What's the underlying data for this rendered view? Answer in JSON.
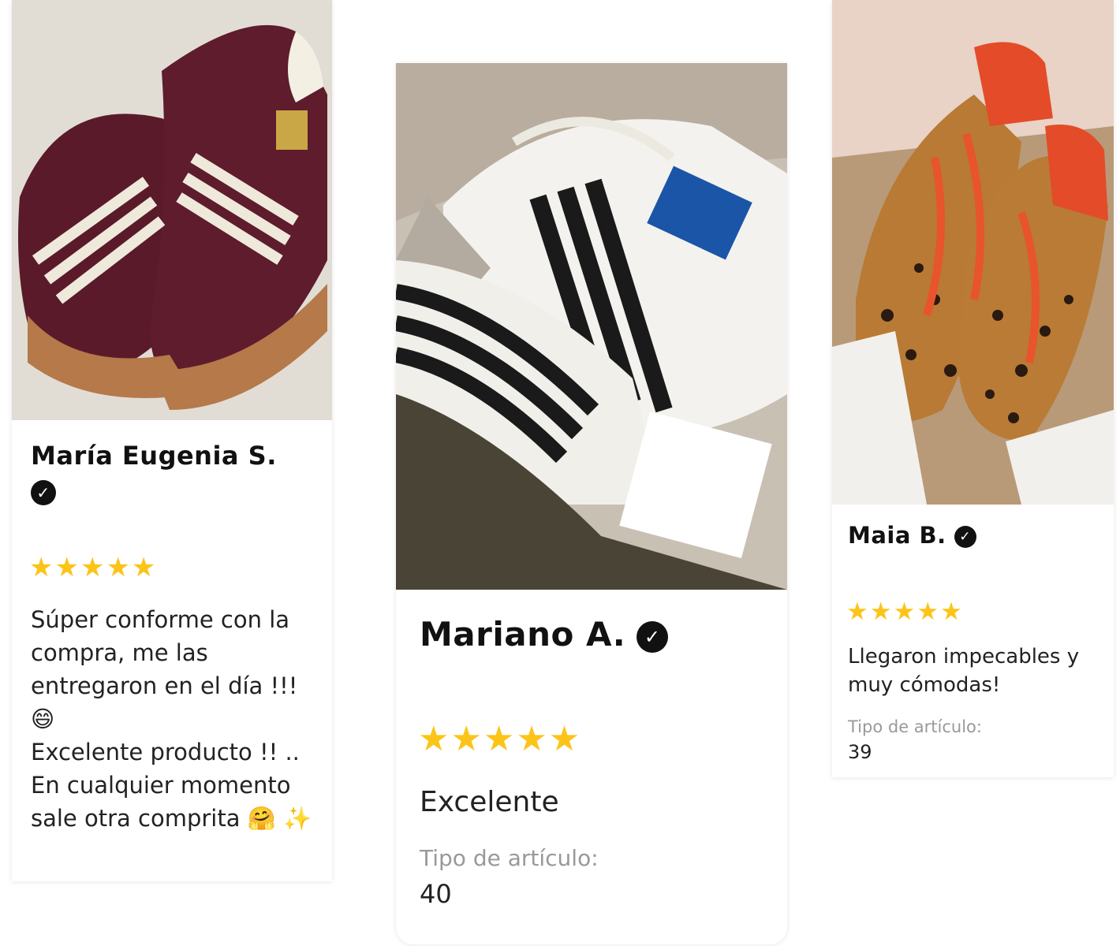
{
  "reviews": [
    {
      "author": "María Eugenia S.",
      "verified_icon": "verified-check-icon",
      "rating": 5,
      "stars": "★★★★★",
      "text": "Súper conforme con la compra, me las entregaron en el día !!! 😄\nExcelente producto !! .. En cualquier momento sale otra comprita 🤗 ✨",
      "photo": "burgundy-samba-sneakers-photo"
    },
    {
      "author": "Mariano A.",
      "verified_icon": "verified-check-icon",
      "rating": 5,
      "stars": "★★★★★",
      "text": "Excelente",
      "item_type_label": "Tipo de artículo:",
      "item_type_value": "40",
      "photo": "white-samba-sneakers-photo"
    },
    {
      "author": "Maia B.",
      "verified_icon": "verified-check-icon",
      "rating": 5,
      "stars": "★★★★★",
      "text": "Llegaron impecables y muy cómodas!",
      "item_type_label": "Tipo de artículo:",
      "item_type_value": "39",
      "photo": "leopard-samba-sneakers-photo"
    }
  ],
  "colors": {
    "star": "#fcc419",
    "check_bg": "#111111",
    "label": "#999999"
  }
}
